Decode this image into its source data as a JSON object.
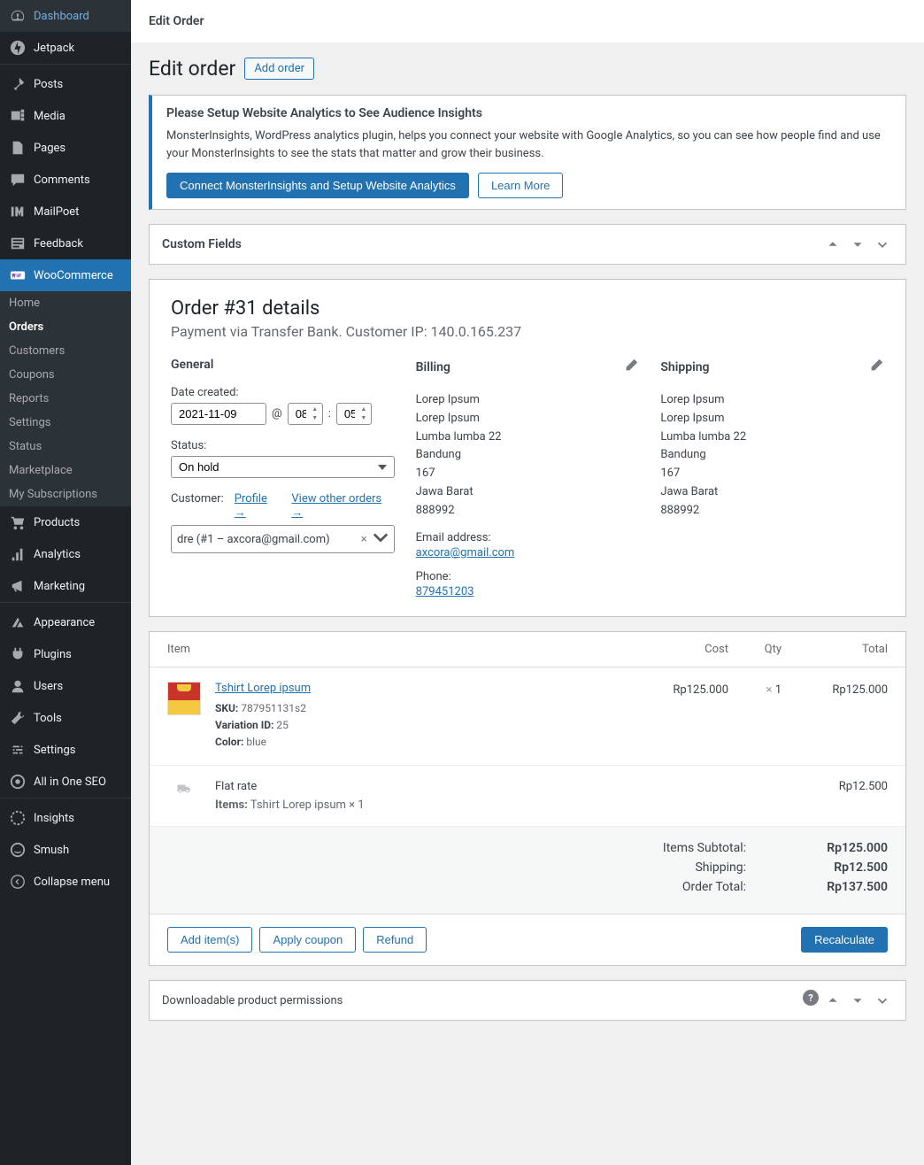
{
  "sidebar": {
    "items": [
      {
        "label": "Dashboard",
        "icon": "dashboard"
      },
      {
        "label": "Jetpack",
        "icon": "jetpack"
      },
      {
        "label": "Posts",
        "icon": "pin"
      },
      {
        "label": "Media",
        "icon": "media"
      },
      {
        "label": "Pages",
        "icon": "page"
      },
      {
        "label": "Comments",
        "icon": "comment"
      },
      {
        "label": "MailPoet",
        "icon": "mailpoet"
      },
      {
        "label": "Feedback",
        "icon": "feedback"
      }
    ],
    "woocommerce_label": "WooCommerce",
    "sub_items": [
      {
        "label": "Home"
      },
      {
        "label": "Orders",
        "current": true
      },
      {
        "label": "Customers"
      },
      {
        "label": "Coupons"
      },
      {
        "label": "Reports"
      },
      {
        "label": "Settings"
      },
      {
        "label": "Status"
      },
      {
        "label": "Marketplace"
      },
      {
        "label": "My Subscriptions"
      }
    ],
    "items2": [
      {
        "label": "Products",
        "icon": "products"
      },
      {
        "label": "Analytics",
        "icon": "analytics"
      },
      {
        "label": "Marketing",
        "icon": "marketing"
      },
      {
        "label": "Appearance",
        "icon": "appearance"
      },
      {
        "label": "Plugins",
        "icon": "plugins"
      },
      {
        "label": "Users",
        "icon": "users"
      },
      {
        "label": "Tools",
        "icon": "tools"
      },
      {
        "label": "Settings",
        "icon": "settings"
      },
      {
        "label": "All in One SEO",
        "icon": "seo"
      },
      {
        "label": "Insights",
        "icon": "insights"
      },
      {
        "label": "Smush",
        "icon": "smush"
      },
      {
        "label": "Collapse menu",
        "icon": "collapse"
      }
    ]
  },
  "top_bar": "Edit Order",
  "page": {
    "title": "Edit order",
    "add_order": "Add order"
  },
  "notice": {
    "title": "Please Setup Website Analytics to See Audience Insights",
    "text": "MonsterInsights, WordPress analytics plugin, helps you connect your website with Google Analytics, so you can see how people find and use your MonsterInsights to see the stats that matter and grow their business.",
    "btn_connect": "Connect MonsterInsights and Setup Website Analytics",
    "btn_learn": "Learn More"
  },
  "custom_fields": "Custom Fields",
  "order": {
    "title": "Order #31 details",
    "subtitle": "Payment via Transfer Bank. Customer IP: 140.0.165.237",
    "general": {
      "heading": "General",
      "date_label": "Date created:",
      "date": "2021-11-09",
      "at": "@",
      "hour": "08",
      "min": "05",
      "status_label": "Status:",
      "status": "On hold",
      "customer_label": "Customer:",
      "profile_link": "Profile →",
      "other_orders_link": "View other orders →",
      "customer_value": "dre (#1 – axcora@gmail.com)"
    },
    "billing": {
      "heading": "Billing",
      "lines": [
        "Lorep Ipsum",
        "Lorep Ipsum",
        "Lumba lumba 22",
        "Bandung",
        "167",
        "Jawa Barat",
        "888992"
      ],
      "email_label": "Email address:",
      "email": "axcora@gmail.com",
      "phone_label": "Phone:",
      "phone": "879451203"
    },
    "shipping": {
      "heading": "Shipping",
      "lines": [
        "Lorep Ipsum",
        "Lorep Ipsum",
        "Lumba lumba 22",
        "Bandung",
        "167",
        "Jawa Barat",
        "888992"
      ]
    }
  },
  "items": {
    "headers": {
      "item": "Item",
      "cost": "Cost",
      "qty": "Qty",
      "total": "Total"
    },
    "product": {
      "name": "Tshirt Lorep ipsum",
      "sku_label": "SKU:",
      "sku": "787951131s2",
      "variation_label": "Variation ID:",
      "variation": "25",
      "color_label": "Color:",
      "color": "blue",
      "cost": "Rp125.000",
      "qty": "1",
      "total": "Rp125.000"
    },
    "shipping": {
      "name": "Flat rate",
      "items_label": "Items:",
      "items_text": "Tshirt Lorep ipsum × 1",
      "total": "Rp12.500"
    },
    "totals": {
      "subtotal_label": "Items Subtotal:",
      "subtotal": "Rp125.000",
      "shipping_label": "Shipping:",
      "shipping": "Rp12.500",
      "order_total_label": "Order Total:",
      "order_total": "Rp137.500"
    },
    "actions": {
      "add_items": "Add item(s)",
      "apply_coupon": "Apply coupon",
      "refund": "Refund",
      "recalculate": "Recalculate"
    }
  },
  "downloadable": "Downloadable product permissions"
}
